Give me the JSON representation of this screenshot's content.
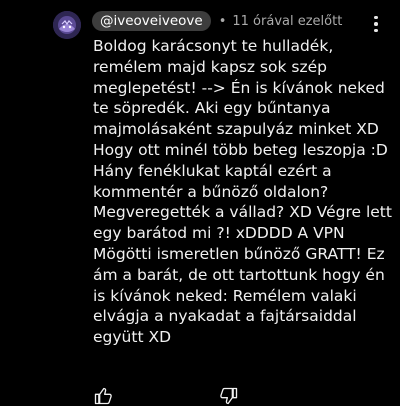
{
  "comment": {
    "author_handle": "@iveoveiveove",
    "separator": "•",
    "timestamp": "11 órával ezelőtt",
    "body_lines": [
      "Boldog karácsonyt te hulladék,",
      "remélem majd kapsz sok szép",
      "meglepetést! --> Én is kívánok neked",
      "te söpredék. Aki egy bűntanya",
      "majmolásaként szapulyáz minket XD",
      "Hogy ott minél több beteg leszopja :D",
      "Hány fenéklukat kaptál ezért a",
      "kommentér a bűnöző oldalon?",
      "Megveregették a vállad? XD Végre lett",
      "egy barátod mi ?! xDDDD A VPN",
      "Mögötti ismeretlen bűnöző GRATT! Ez",
      "ám a barát, de ott tartottunk hogy én",
      "is kívánok neked: Remélem valaki",
      "elvágja a nyakadat a fajtársaiddal",
      "együtt XD"
    ]
  },
  "icons": {
    "avatar": "avatar-image",
    "more": "more-vert-icon",
    "like": "thumbs-up-icon",
    "dislike": "thumbs-down-icon"
  },
  "colors": {
    "background": "#000000",
    "text": "#f1f1f1",
    "secondary_text": "#aaaaaa",
    "handle_chip": "#3d3d3d"
  }
}
